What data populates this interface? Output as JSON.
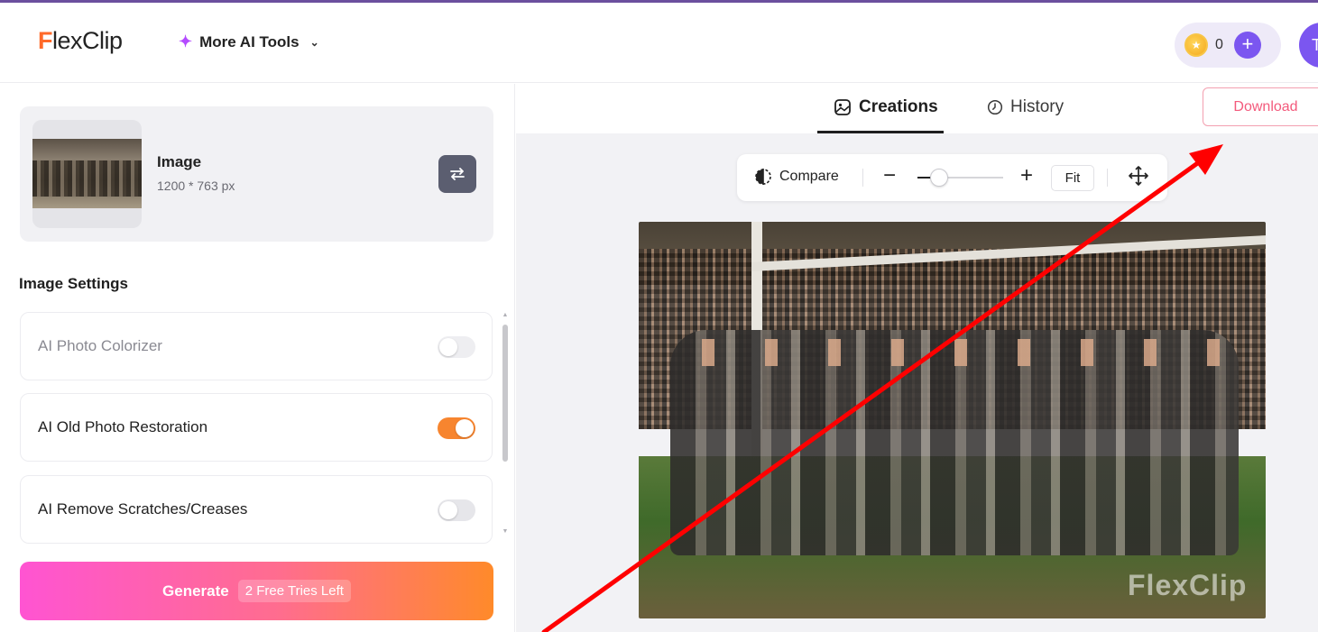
{
  "header": {
    "logo_f": "F",
    "logo_rest": "lexClip",
    "ai_tools_label": "More AI Tools",
    "credit_count": "0",
    "avatar_initial": "T"
  },
  "left_panel": {
    "image_title": "Image",
    "image_size": "1200 * 763 px",
    "settings_title": "Image Settings",
    "options": [
      {
        "label": "AI Photo Colorizer",
        "enabled": false,
        "disabled": true
      },
      {
        "label": "AI Old Photo Restoration",
        "enabled": true,
        "disabled": false
      },
      {
        "label": "AI Remove Scratches/Creases",
        "enabled": false,
        "disabled": false
      }
    ],
    "generate_label": "Generate",
    "free_tries": "2 Free Tries Left"
  },
  "right_panel": {
    "tabs": [
      {
        "label": "Creations",
        "active": true
      },
      {
        "label": "History",
        "active": false
      }
    ],
    "download_label": "Download",
    "toolbar": {
      "compare_label": "Compare",
      "fit_label": "Fit"
    },
    "watermark_text": "FlexClip"
  },
  "colors": {
    "accent_purple": "#7b56f0",
    "toggle_on": "#f7852f",
    "download_pink": "#f35a7c",
    "annotation_red": "#ff0000"
  },
  "icons": {
    "ai_tools": "sparkle-icon",
    "dropdown": "chevron-down-icon",
    "coin": "coin-icon",
    "add_credits": "plus-icon",
    "swap": "swap-icon",
    "creations": "image-icon",
    "history": "clock-icon",
    "compare": "compare-icon",
    "zoom_out": "minus-icon",
    "zoom_in": "plus-icon",
    "move": "move-icon"
  }
}
